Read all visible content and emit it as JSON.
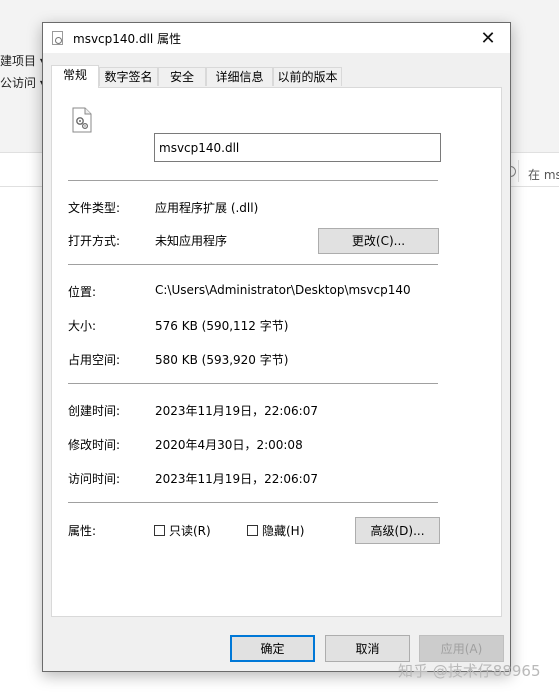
{
  "background": {
    "ribbon_item_1": "建项目 ▾",
    "ribbon_item_2": "公访问 ▾",
    "search_hint": "在 ms"
  },
  "watermark": "知乎 @技术仔88965",
  "dialog": {
    "title": "msvcp140.dll 属性",
    "close_glyph": "✕",
    "tabs": [
      "常规",
      "数字签名",
      "安全",
      "详细信息",
      "以前的版本"
    ],
    "active_tab": 0,
    "file_name": "msvcp140.dll",
    "fields": {
      "type_label": "文件类型:",
      "type_value": "应用程序扩展 (.dll)",
      "opens_with_label": "打开方式:",
      "opens_with_value": "未知应用程序",
      "change_button": "更改(C)...",
      "location_label": "位置:",
      "location_value": "C:\\Users\\Administrator\\Desktop\\msvcp140",
      "size_label": "大小:",
      "size_value": "576 KB (590,112 字节)",
      "size_on_disk_label": "占用空间:",
      "size_on_disk_value": "580 KB (593,920 字节)",
      "created_label": "创建时间:",
      "created_value": "2023年11月19日，22:06:07",
      "modified_label": "修改时间:",
      "modified_value": "2020年4月30日，2:00:08",
      "accessed_label": "访问时间:",
      "accessed_value": "2023年11月19日，22:06:07",
      "attributes_label": "属性:",
      "readonly_label": "只读(R)",
      "readonly_checked": false,
      "hidden_label": "隐藏(H)",
      "hidden_checked": false,
      "advanced_button": "高级(D)..."
    },
    "buttons": {
      "ok": "确定",
      "cancel": "取消",
      "apply": "应用(A)"
    }
  },
  "icons": {
    "file_icon": "dll-file-gear-icon",
    "title_icon": "dll-file-icon",
    "close_icon": "close-icon"
  },
  "colors": {
    "ok_border": "#0078d7",
    "dialog_bg": "#f0f0f0",
    "panel_bg": "#ffffff"
  }
}
